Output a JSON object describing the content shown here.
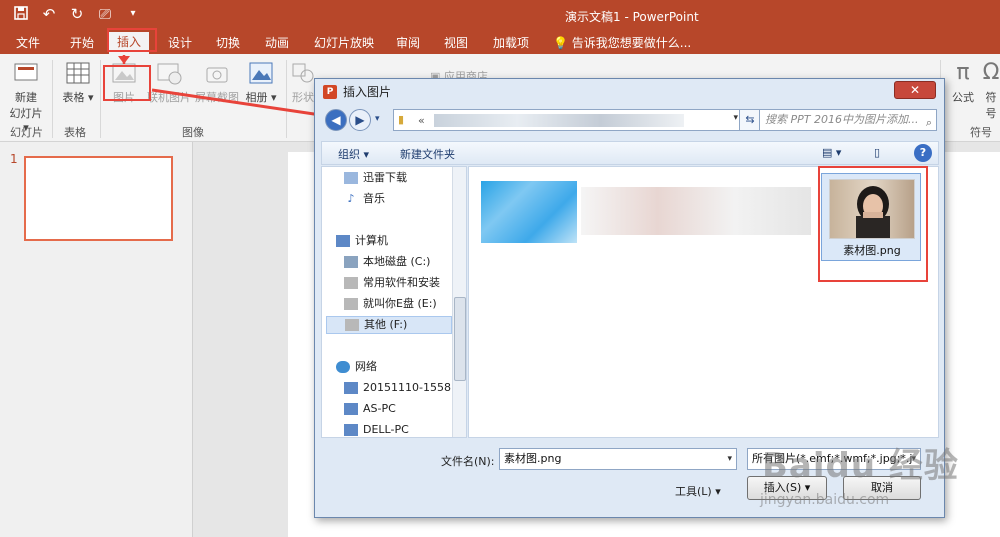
{
  "window": {
    "title": "演示文稿1 - PowerPoint"
  },
  "tabs": [
    "文件",
    "开始",
    "插入",
    "设计",
    "切换",
    "动画",
    "幻灯片放映",
    "审阅",
    "视图",
    "加载项"
  ],
  "tell_me": "告诉我您想要做什么...",
  "ribbon": {
    "new_slide": "新建",
    "new_slide2": "幻灯片",
    "table": "表格",
    "picture": "图片",
    "online_pictures": "联机图片",
    "screenshot": "屏幕截图",
    "album": "相册",
    "shapes": "形状",
    "app_store": "应用商店",
    "equation": "公式",
    "symbol": "符号",
    "group_slides": "幻灯片",
    "group_tables": "表格",
    "group_images": "图像",
    "group_symbols": "符号"
  },
  "slides": {
    "current": "1"
  },
  "dialog": {
    "title": "插入图片",
    "close": "✕",
    "address_prefix": "«",
    "search_placeholder": "搜索 PPT 2016中为图片添加...",
    "organize": "组织 ▾",
    "new_folder": "新建文件夹",
    "help": "?",
    "nav_items": [
      "迅雷下载",
      "音乐",
      "计算机",
      "本地磁盘 (C:)",
      "常用软件和安装",
      "就叫你E盘 (E:)",
      "其他 (F:)",
      "网络",
      "20151110-1558",
      "AS-PC",
      "DELL-PC"
    ],
    "file": {
      "name": "素材图.png"
    },
    "filename_label": "文件名(N):",
    "filename_value": "素材图.png",
    "filetype_value": "所有图片(*.emf;*.wmf;*.jpg;*.j",
    "tools": "工具(L)",
    "insert": "插入(S)",
    "cancel": "取消"
  },
  "watermark": {
    "main": "Baidu 经验",
    "sub": "jingyan.baidu.com"
  },
  "colors": {
    "accent": "#b7472a",
    "annotation": "#e8433a",
    "dialog_bg": "#dfe9f5"
  }
}
